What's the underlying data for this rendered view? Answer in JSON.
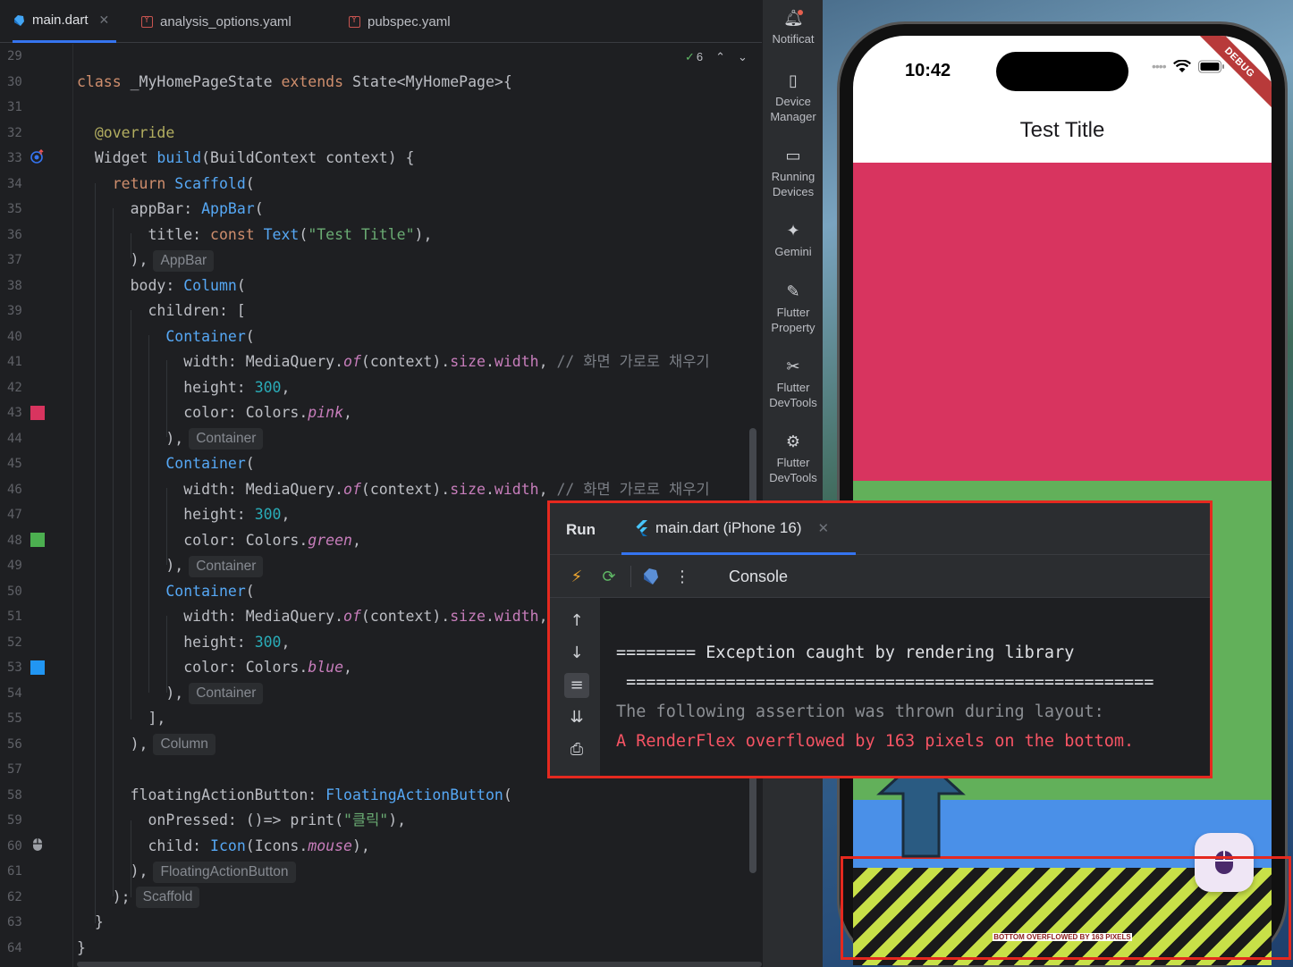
{
  "tabs": [
    {
      "label": "main.dart",
      "icon": "dart-file-icon",
      "active": true
    },
    {
      "label": "analysis_options.yaml",
      "icon": "yaml-file-icon",
      "active": false
    },
    {
      "label": "pubspec.yaml",
      "icon": "yaml-file-icon",
      "active": false
    }
  ],
  "editor": {
    "inspection_count": "6",
    "line_numbers": [
      "29",
      "30",
      "31",
      "32",
      "33",
      "34",
      "35",
      "36",
      "37",
      "38",
      "39",
      "40",
      "41",
      "42",
      "43",
      "44",
      "45",
      "46",
      "47",
      "48",
      "49",
      "50",
      "51",
      "52",
      "53",
      "54",
      "55",
      "56",
      "57",
      "58",
      "59",
      "60",
      "61",
      "62",
      "63",
      "64"
    ],
    "hints": {
      "appbar": "AppBar",
      "container1": "Container",
      "container2": "Container",
      "container3": "Container",
      "column": "Column",
      "fab": "FloatingActionButton",
      "scaffold": "Scaffold"
    },
    "gutter_colors": {
      "pink": "#d8345f",
      "green": "#4caf50",
      "blue": "#2196f3"
    }
  },
  "toolstrip": [
    {
      "label": "Notificat",
      "icon": "bell-icon"
    },
    {
      "label": "Device Manager",
      "icon": "device-manager-icon"
    },
    {
      "label": "Running Devices",
      "icon": "running-devices-icon"
    },
    {
      "label": "Gemini",
      "icon": "gemini-icon"
    },
    {
      "label": "Flutter Property",
      "icon": "flutter-property-icon"
    },
    {
      "label": "Flutter DevTools",
      "icon": "flutter-devtools-icon"
    },
    {
      "label": "Flutter DevTools",
      "icon": "flutter-devtools-icon"
    }
  ],
  "phone": {
    "time": "10:42",
    "debug_banner": "DEBUG",
    "appbar_title": "Test Title",
    "overflow_label": "BOTTOM OVERFLOWED BY 163 PIXELS",
    "colors": {
      "pink": "#d8345f",
      "green": "#62b05a",
      "blue": "#4a90e8"
    },
    "fab_icon": "mouse-icon"
  },
  "run_panel": {
    "label": "Run",
    "tab_label": "main.dart (iPhone 16)",
    "console_label": "Console",
    "lines": [
      "======== Exception caught by rendering library",
      " =====================================================",
      "The following assertion was thrown during layout:",
      "A RenderFlex overflowed by 163 pixels on the bottom."
    ]
  }
}
